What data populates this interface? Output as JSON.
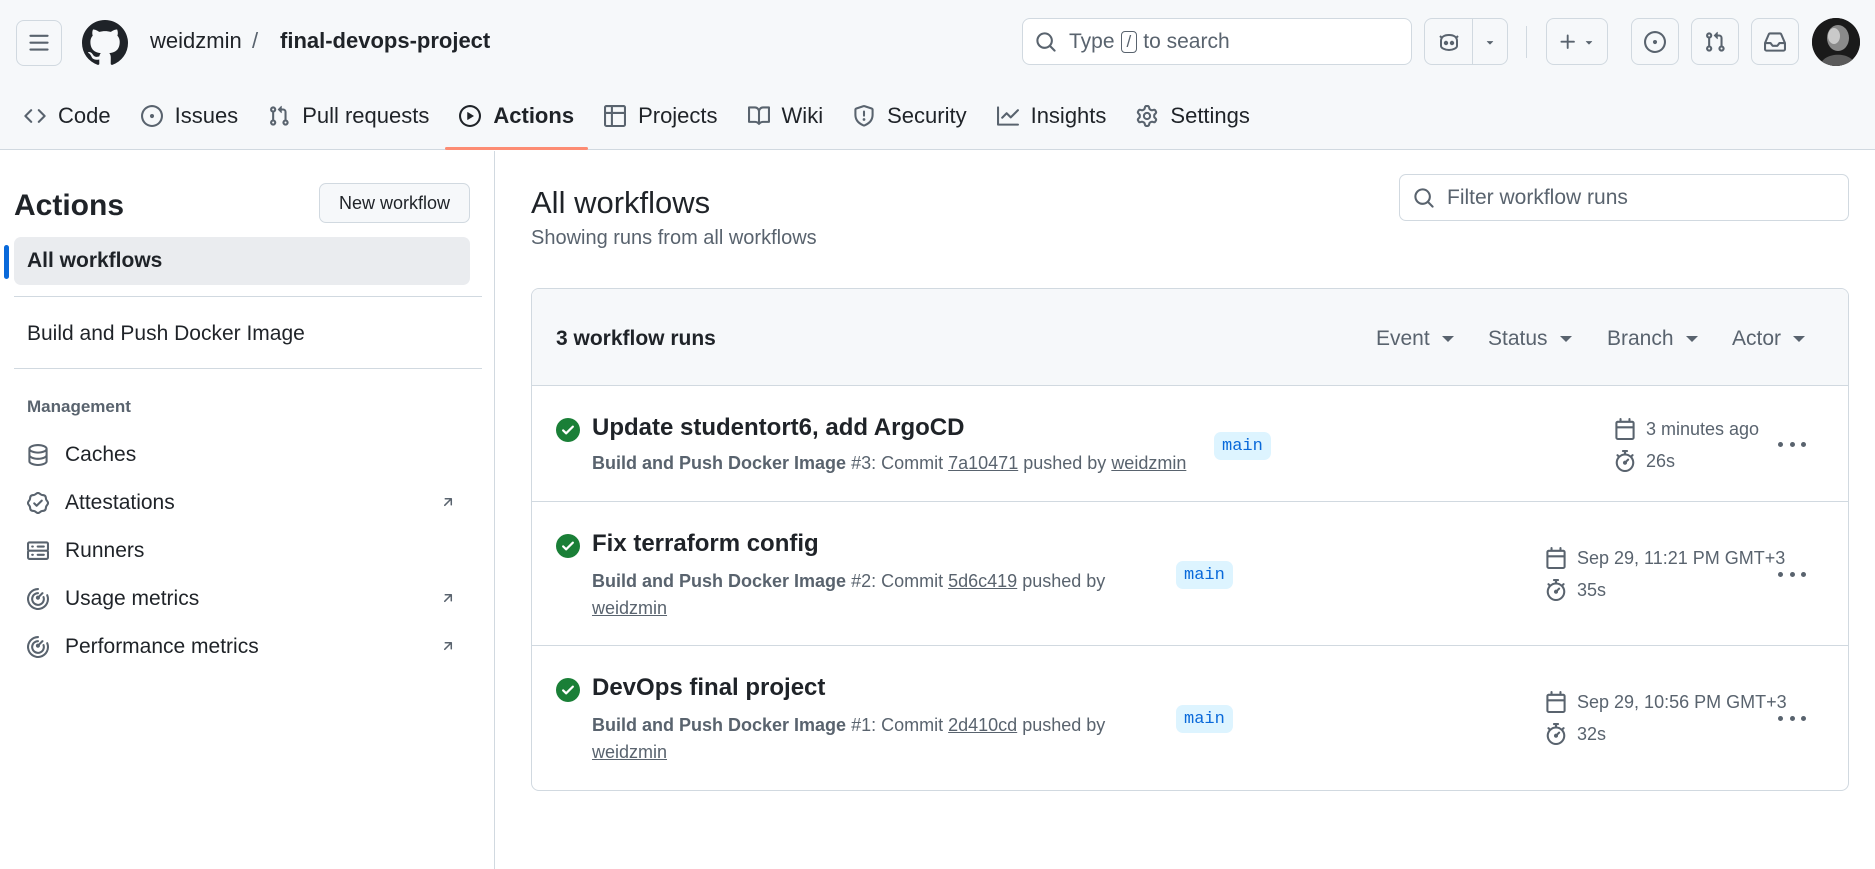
{
  "header": {
    "owner": "weidzmin",
    "separator": "/",
    "repo": "final-devops-project",
    "search_pre": "Type",
    "search_key": "/",
    "search_post": "to search"
  },
  "nav": {
    "tabs": [
      {
        "label": "Code",
        "icon": "code-icon"
      },
      {
        "label": "Issues",
        "icon": "issue-icon"
      },
      {
        "label": "Pull requests",
        "icon": "pull-request-icon"
      },
      {
        "label": "Actions",
        "icon": "play-icon",
        "active": true
      },
      {
        "label": "Projects",
        "icon": "table-icon"
      },
      {
        "label": "Wiki",
        "icon": "book-icon"
      },
      {
        "label": "Security",
        "icon": "shield-icon"
      },
      {
        "label": "Insights",
        "icon": "graph-icon"
      },
      {
        "label": "Settings",
        "icon": "gear-icon"
      }
    ]
  },
  "sidebar": {
    "title": "Actions",
    "new_workflow": "New workflow",
    "all_workflows": "All workflows",
    "workflow": "Build and Push Docker Image",
    "management_heading": "Management",
    "management": [
      {
        "label": "Caches",
        "icon": "database-icon"
      },
      {
        "label": "Attestations",
        "icon": "verified-icon",
        "external": true
      },
      {
        "label": "Runners",
        "icon": "server-icon"
      },
      {
        "label": "Usage metrics",
        "icon": "meter-icon",
        "external": true
      },
      {
        "label": "Performance metrics",
        "icon": "meter-icon",
        "external": true
      }
    ]
  },
  "main": {
    "title": "All workflows",
    "subtitle": "Showing runs from all workflows",
    "filter_placeholder": "Filter workflow runs",
    "run_count": "3 workflow runs",
    "filters": [
      "Event",
      "Status",
      "Branch",
      "Actor"
    ],
    "runs": [
      {
        "title": "Update studentort6, add ArgoCD",
        "workflow": "Build and Push Docker Image",
        "number": "#3",
        "commit_label": ": Commit",
        "commit": "7a10471",
        "pushed_by": "pushed by",
        "user": "weidzmin",
        "branch": "main",
        "time": "3 minutes ago",
        "duration": "26s",
        "status": "success"
      },
      {
        "title": "Fix terraform config",
        "workflow": "Build and Push Docker Image",
        "number": "#2",
        "commit_label": ": Commit",
        "commit": "5d6c419",
        "pushed_by": "pushed by",
        "user": "weidzmin",
        "branch": "main",
        "time": "Sep 29, 11:21 PM GMT+3",
        "duration": "35s",
        "status": "success"
      },
      {
        "title": "DevOps final project",
        "workflow": "Build and Push Docker Image",
        "number": "#1",
        "commit_label": ": Commit",
        "commit": "2d410cd",
        "pushed_by": "pushed by",
        "user": "weidzmin",
        "branch": "main",
        "time": "Sep 29, 10:56 PM GMT+3",
        "duration": "32s",
        "status": "success"
      }
    ]
  },
  "colors": {
    "success": "#1a7f37",
    "link_blue": "#0969da",
    "active_tab_underline": "#fd8c73",
    "header_bg": "#f6f8fa"
  }
}
